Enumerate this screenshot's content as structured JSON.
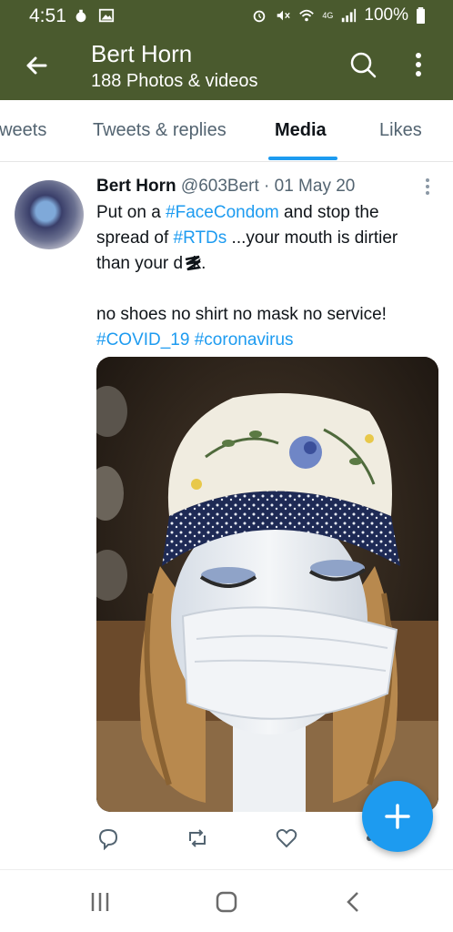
{
  "status_bar": {
    "time": "4:51",
    "network": "4G",
    "battery": "100%"
  },
  "app_bar": {
    "title": "Bert Horn",
    "subtitle": "188 Photos & videos"
  },
  "tabs": [
    {
      "label": "Tweets"
    },
    {
      "label": "Tweets & replies"
    },
    {
      "label": "Media",
      "active": true
    },
    {
      "label": "Likes"
    }
  ],
  "tweet": {
    "author": "Bert Horn",
    "handle": "@603Bert",
    "separator": "·",
    "date": "01 May 20",
    "line1_a": "Put on a ",
    "line1_tag": "#FaceCondom",
    "line1_b": " and stop the",
    "line2_a": "spread of ",
    "line2_tag": "#RTDs",
    "line2_b": " ...your mouth is dirtier",
    "line3": "than your d  k.",
    "line4": "no shoes no shirt no mask no service!",
    "tag_a": "#COVID_19",
    "tag_b": "#coronavirus"
  },
  "colors": {
    "app_bar": "#4a5a2e",
    "accent": "#1d9bf0",
    "secondary_text": "#536471"
  },
  "icons": {
    "back": "arrow-left-icon",
    "search": "search-icon",
    "more": "more-vertical-icon",
    "reply": "reply-icon",
    "retweet": "retweet-icon",
    "like": "heart-icon",
    "share": "share-icon",
    "compose": "plus-icon",
    "nav_recent": "recent-apps-icon",
    "nav_home": "home-icon",
    "nav_back": "back-chevron-icon"
  }
}
